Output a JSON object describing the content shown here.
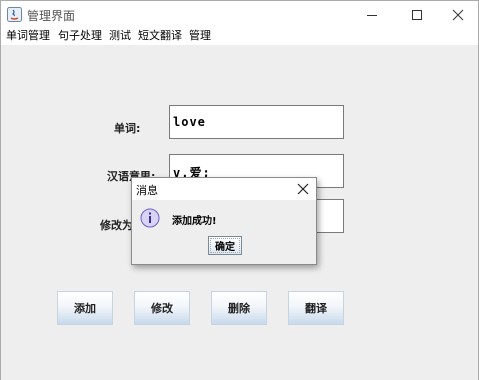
{
  "window": {
    "title": "管理界面",
    "controls": [
      "minimize-icon",
      "maximize-icon",
      "close-icon"
    ]
  },
  "menubar": {
    "items": [
      {
        "label": "单词管理"
      },
      {
        "label": "句子处理"
      },
      {
        "label": "测试"
      },
      {
        "label": "短文翻译"
      },
      {
        "label": "管理"
      }
    ]
  },
  "form": {
    "word_label": "单词:",
    "word_value": "love",
    "meaning_label": "汉语意思:",
    "meaning_value": "v.爱;",
    "modify_label": "修改为",
    "modify_value": ""
  },
  "buttons": {
    "add": "添加",
    "modify": "修改",
    "delete": "删除",
    "translate": "翻译"
  },
  "dialog": {
    "title": "消息",
    "icon": "info-icon",
    "message": "添加成功!",
    "ok_label": "确定"
  },
  "colors": {
    "background": "#eeeeee",
    "button_gradient_bottom": "#c8d9ec",
    "info_icon": "#7b6fd0"
  }
}
